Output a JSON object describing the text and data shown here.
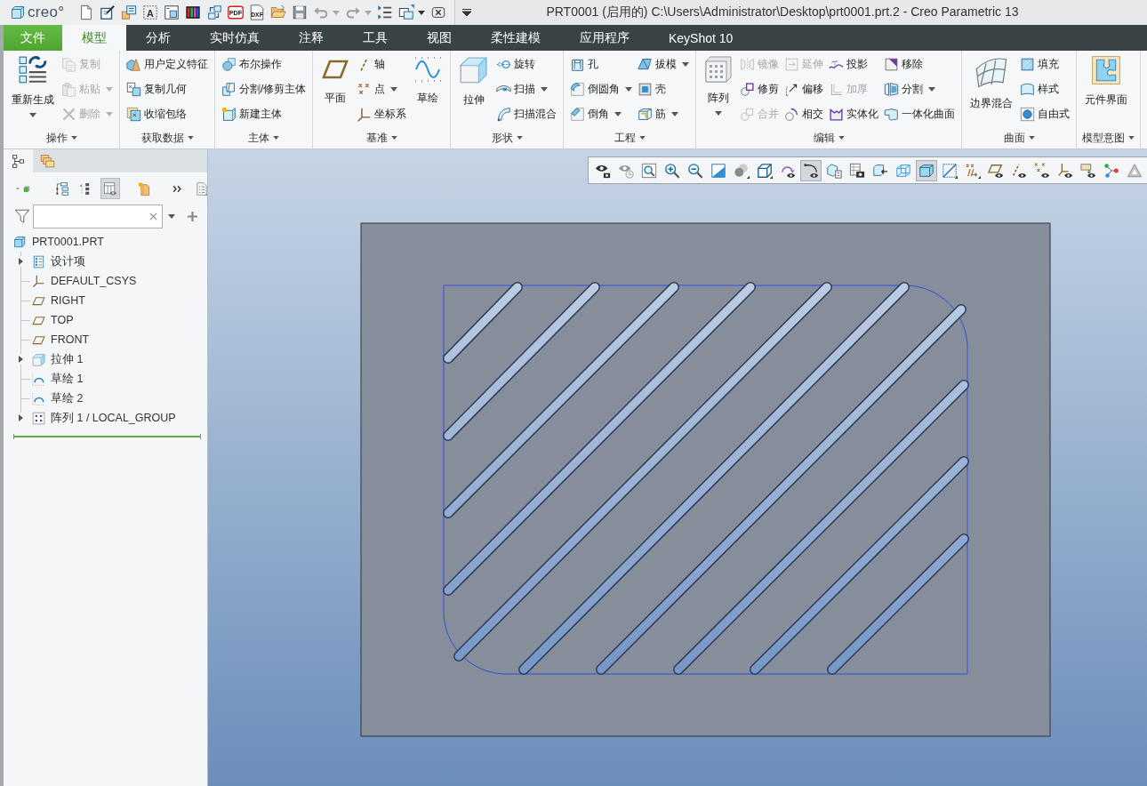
{
  "title_bar": {
    "logo": "creo°",
    "title": "PRT0001 (启用的) C:\\Users\\Administrator\\Desktop\\prt0001.prt.2 - Creo Parametric 13"
  },
  "quick_access_toolbar": {
    "icon_labels": [
      "A",
      "PDF",
      "DXF"
    ]
  },
  "tabs": [
    {
      "label": "文件",
      "kind": "file",
      "selected": false
    },
    {
      "label": "模型",
      "kind": "tab",
      "selected": true
    },
    {
      "label": "分析",
      "kind": "tab",
      "selected": false
    },
    {
      "label": "实时仿真",
      "kind": "tab",
      "selected": false
    },
    {
      "label": "注释",
      "kind": "tab",
      "selected": false
    },
    {
      "label": "工具",
      "kind": "tab",
      "selected": false
    },
    {
      "label": "视图",
      "kind": "tab",
      "selected": false
    },
    {
      "label": "柔性建模",
      "kind": "tab",
      "selected": false
    },
    {
      "label": "应用程序",
      "kind": "tab",
      "selected": false
    },
    {
      "label": "KeyShot 10",
      "kind": "tab",
      "selected": false
    }
  ],
  "ribbon": {
    "groups": [
      {
        "label": "操作",
        "items": [
          {
            "label": "重新生成",
            "kind": "large",
            "disabled": false,
            "has_menu": true
          },
          {
            "label": "复制",
            "kind": "small",
            "disabled": true,
            "has_menu": false
          },
          {
            "label": "粘贴",
            "kind": "small",
            "disabled": true,
            "has_menu": true
          },
          {
            "label": "删除",
            "kind": "small",
            "disabled": true,
            "has_menu": true
          }
        ]
      },
      {
        "label": "获取数据",
        "items": [
          {
            "label": "用户定义特征",
            "kind": "small",
            "disabled": false,
            "has_menu": false
          },
          {
            "label": "复制几何",
            "kind": "small",
            "disabled": false,
            "has_menu": false
          },
          {
            "label": "收缩包络",
            "kind": "small",
            "disabled": false,
            "has_menu": false
          }
        ]
      },
      {
        "label": "主体",
        "items": [
          {
            "label": "布尔操作",
            "kind": "small",
            "disabled": false,
            "has_menu": false
          },
          {
            "label": "分割/修剪主体",
            "kind": "small",
            "disabled": false,
            "has_menu": false
          },
          {
            "label": "新建主体",
            "kind": "small",
            "disabled": false,
            "has_menu": false
          }
        ]
      },
      {
        "label": "基准",
        "items": [
          {
            "label": "平面",
            "kind": "large",
            "disabled": false,
            "has_menu": false
          },
          {
            "label": "轴",
            "kind": "small",
            "disabled": false,
            "has_menu": false
          },
          {
            "label": "点",
            "kind": "small",
            "disabled": false,
            "has_menu": true
          },
          {
            "label": "坐标系",
            "kind": "small",
            "disabled": false,
            "has_menu": false
          },
          {
            "label": "草绘",
            "kind": "large",
            "disabled": false,
            "has_menu": false
          }
        ]
      },
      {
        "label": "形状",
        "items": [
          {
            "label": "拉伸",
            "kind": "large",
            "disabled": false,
            "has_menu": false
          },
          {
            "label": "旋转",
            "kind": "small",
            "disabled": false,
            "has_menu": false
          },
          {
            "label": "扫描",
            "kind": "small",
            "disabled": false,
            "has_menu": true
          },
          {
            "label": "扫描混合",
            "kind": "small",
            "disabled": false,
            "has_menu": false
          }
        ]
      },
      {
        "label": "工程",
        "items": [
          {
            "label": "孔",
            "kind": "small",
            "disabled": false,
            "has_menu": false
          },
          {
            "label": "倒圆角",
            "kind": "small",
            "disabled": false,
            "has_menu": true
          },
          {
            "label": "倒角",
            "kind": "small",
            "disabled": false,
            "has_menu": true
          },
          {
            "label": "拔模",
            "kind": "small",
            "disabled": false,
            "has_menu": true
          },
          {
            "label": "壳",
            "kind": "small",
            "disabled": false,
            "has_menu": false
          },
          {
            "label": "筋",
            "kind": "small",
            "disabled": false,
            "has_menu": true
          }
        ]
      },
      {
        "label": "编辑",
        "items": [
          {
            "label": "阵列",
            "kind": "large",
            "disabled": false,
            "has_menu": true
          },
          {
            "label": "镜像",
            "kind": "small",
            "disabled": true,
            "has_menu": false
          },
          {
            "label": "修剪",
            "kind": "small",
            "disabled": false,
            "has_menu": false
          },
          {
            "label": "合并",
            "kind": "small",
            "disabled": true,
            "has_menu": false
          },
          {
            "label": "延伸",
            "kind": "small",
            "disabled": true,
            "has_menu": false
          },
          {
            "label": "偏移",
            "kind": "small",
            "disabled": false,
            "has_menu": false
          },
          {
            "label": "相交",
            "kind": "small",
            "disabled": false,
            "has_menu": false
          },
          {
            "label": "投影",
            "kind": "small",
            "disabled": false,
            "has_menu": false
          },
          {
            "label": "加厚",
            "kind": "small",
            "disabled": true,
            "has_menu": false
          },
          {
            "label": "实体化",
            "kind": "small",
            "disabled": false,
            "has_menu": false
          },
          {
            "label": "移除",
            "kind": "small",
            "disabled": false,
            "has_menu": false
          },
          {
            "label": "分割",
            "kind": "small",
            "disabled": false,
            "has_menu": true
          },
          {
            "label": "一体化曲面",
            "kind": "small",
            "disabled": false,
            "has_menu": false
          }
        ]
      },
      {
        "label": "曲面",
        "items": [
          {
            "label": "边界混合",
            "kind": "large",
            "disabled": false,
            "has_menu": false
          },
          {
            "label": "填充",
            "kind": "small",
            "disabled": false,
            "has_menu": false
          },
          {
            "label": "样式",
            "kind": "small",
            "disabled": false,
            "has_menu": false
          },
          {
            "label": "自由式",
            "kind": "small",
            "disabled": false,
            "has_menu": false
          }
        ]
      },
      {
        "label": "模型意图",
        "items": [
          {
            "label": "元件界面",
            "kind": "large",
            "disabled": false,
            "has_menu": false
          }
        ]
      }
    ]
  },
  "side_panel": {
    "tabs": [
      {
        "selected": true
      },
      {
        "selected": false
      }
    ],
    "toolbar": [
      {
        "on": false
      },
      {
        "on": false
      },
      {
        "on": false
      },
      {
        "on": true
      },
      {
        "on": false
      },
      {
        "on": false
      },
      {
        "on": false
      }
    ],
    "model_tree": {
      "label": "PRT0001.PRT",
      "kind": "part",
      "children": [
        {
          "label": "设计项",
          "kind": "design_items",
          "expandable": true
        },
        {
          "label": "DEFAULT_CSYS",
          "kind": "csys",
          "expandable": false
        },
        {
          "label": "RIGHT",
          "kind": "plane",
          "expandable": false
        },
        {
          "label": "TOP",
          "kind": "plane",
          "expandable": false
        },
        {
          "label": "FRONT",
          "kind": "plane",
          "expandable": false
        },
        {
          "label": "拉伸 1",
          "kind": "extrude",
          "expandable": true
        },
        {
          "label": "草绘 1",
          "kind": "sketch",
          "expandable": false
        },
        {
          "label": "草绘 2",
          "kind": "sketch",
          "expandable": false
        },
        {
          "label": "阵列 1 / LOCAL_GROUP",
          "kind": "pattern",
          "expandable": true
        }
      ]
    }
  },
  "graphics_toolbar": {
    "buttons": [
      {
        "on": false
      },
      {
        "on": false
      },
      {
        "on": false
      },
      {
        "on": false
      },
      {
        "on": false
      },
      {
        "on": false
      },
      {
        "on": false
      },
      {
        "on": false
      },
      {
        "on": false
      },
      {
        "on": true
      },
      {
        "on": false
      },
      {
        "on": false
      },
      {
        "on": false
      },
      {
        "on": false
      },
      {
        "on": true
      },
      {
        "on": false
      },
      {
        "on": false
      },
      {
        "on": false
      },
      {
        "on": false
      },
      {
        "on": false
      },
      {
        "on": false
      },
      {
        "on": false
      },
      {
        "on": false
      },
      {
        "on": false
      }
    ]
  }
}
